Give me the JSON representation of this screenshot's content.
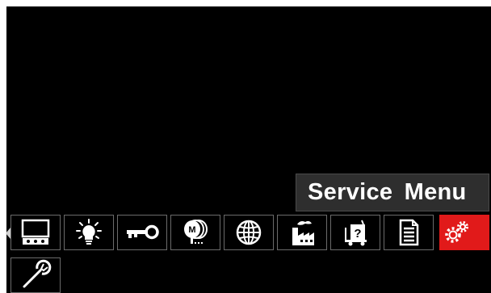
{
  "tooltip": {
    "label": "Service Menu"
  },
  "menu_icons": [
    {
      "name": "display-icon"
    },
    {
      "name": "lightbulb-icon"
    },
    {
      "name": "key-icon"
    },
    {
      "name": "wire-spool-icon"
    },
    {
      "name": "globe-icon"
    },
    {
      "name": "factory-icon"
    },
    {
      "name": "feeder-help-icon"
    },
    {
      "name": "document-icon"
    },
    {
      "name": "gears-icon",
      "selected": true
    },
    {
      "name": "wrench-icon"
    }
  ],
  "colors": {
    "background": "#000000",
    "selected": "#e11a1a",
    "tooltip_bg": "#2e2e2e",
    "tile_border": "#6b6b6b"
  }
}
